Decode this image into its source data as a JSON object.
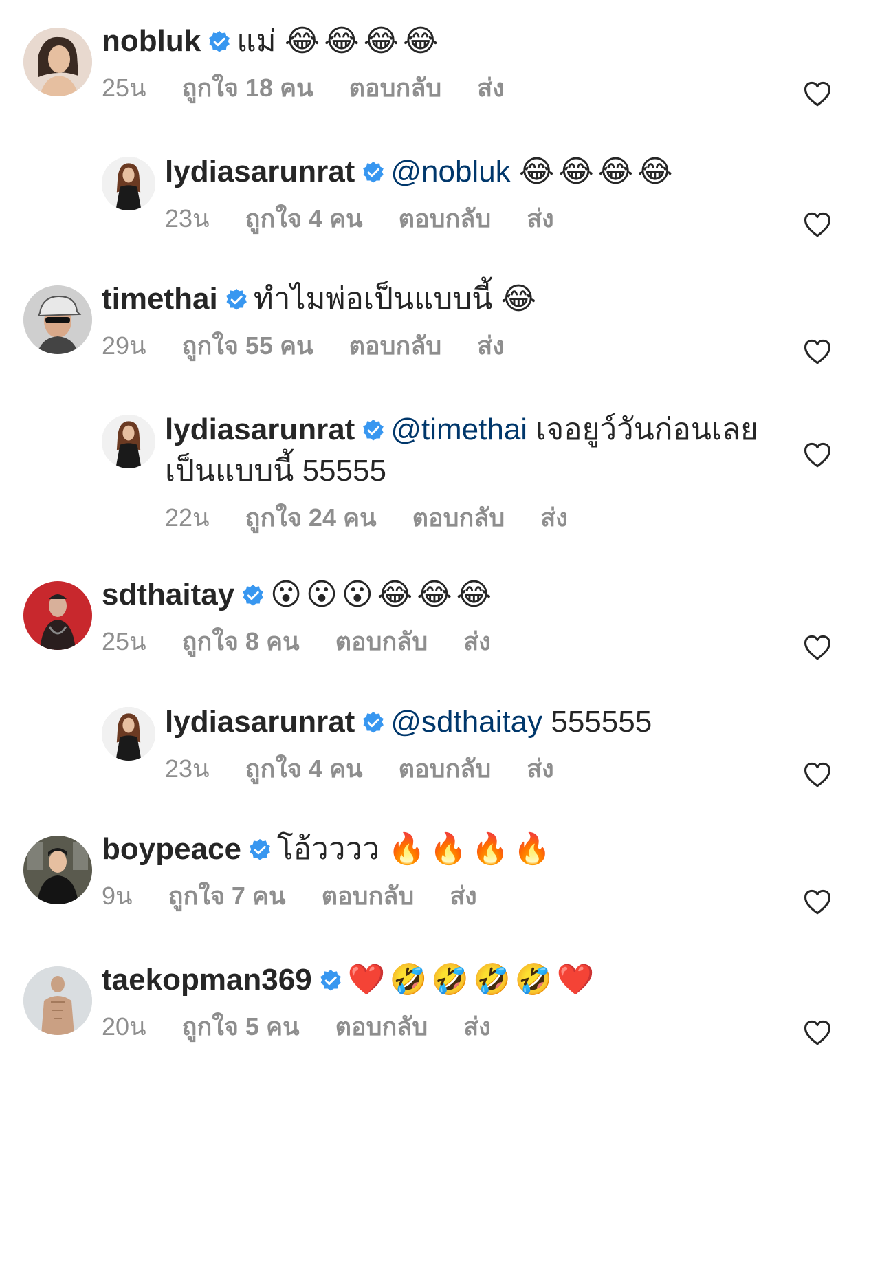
{
  "colors": {
    "text": "#262626",
    "meta": "#8e8e8e",
    "mention": "#00376b",
    "verified": "#3897f0"
  },
  "comments": [
    {
      "username": "nobluk",
      "verified": true,
      "reply": false,
      "mention": "",
      "text": "แม่",
      "emojis": "😂😂😂😂",
      "time": "25น",
      "likes": "ถูกใจ 18 คน",
      "reply_label": "ตอบกลับ",
      "send_label": "ส่ง",
      "avatar": "woman-portrait",
      "avatar_color": "#e8d9cf"
    },
    {
      "username": "lydiasarunrat",
      "verified": true,
      "reply": true,
      "mention": "@nobluk",
      "text": "",
      "emojis": "😂😂😂😂",
      "time": "23น",
      "likes": "ถูกใจ 4 คน",
      "reply_label": "ตอบกลับ",
      "send_label": "ส่ง",
      "avatar": "woman-dark-hair",
      "avatar_color": "#f1f1f1"
    },
    {
      "username": "timethai",
      "verified": true,
      "reply": false,
      "mention": "",
      "text": "ทำไมพ่อเป็นแบบนี้",
      "emojis": "😂",
      "time": "29น",
      "likes": "ถูกใจ 55 คน",
      "reply_label": "ตอบกลับ",
      "send_label": "ส่ง",
      "avatar": "man-cap-sunglasses",
      "avatar_color": "#cfcfcf"
    },
    {
      "username": "lydiasarunrat",
      "verified": true,
      "reply": true,
      "mention": "@timethai",
      "text": "เจอยูว์วันก่อนเลยเป็นแบบนี้ 55555",
      "emojis": "",
      "time": "22น",
      "likes": "ถูกใจ 24 คน",
      "reply_label": "ตอบกลับ",
      "send_label": "ส่ง",
      "avatar": "woman-dark-hair",
      "avatar_color": "#f1f1f1"
    },
    {
      "username": "sdthaitay",
      "verified": true,
      "reply": false,
      "mention": "",
      "text": "",
      "emojis": "😮😮😮😂😂😂",
      "time": "25น",
      "likes": "ถูกใจ 8 คน",
      "reply_label": "ตอบกลับ",
      "send_label": "ส่ง",
      "avatar": "man-red-background",
      "avatar_color": "#c8282d"
    },
    {
      "username": "lydiasarunrat",
      "verified": true,
      "reply": true,
      "mention": "@sdthaitay",
      "text": "555555",
      "emojis": "",
      "time": "23น",
      "likes": "ถูกใจ 4 คน",
      "reply_label": "ตอบกลับ",
      "send_label": "ส่ง",
      "avatar": "woman-dark-hair",
      "avatar_color": "#f1f1f1"
    },
    {
      "username": "boypeace",
      "verified": true,
      "reply": false,
      "mention": "",
      "text": "โอ้วววว",
      "emojis": "🔥🔥🔥🔥",
      "time": "9น",
      "likes": "ถูกใจ 7 คน",
      "reply_label": "ตอบกลับ",
      "send_label": "ส่ง",
      "avatar": "man-leather-jacket",
      "avatar_color": "#5a5a4e"
    },
    {
      "username": "taekopman369",
      "verified": true,
      "reply": false,
      "mention": "",
      "text": "",
      "emojis": "❤️🤣🤣🤣🤣❤️",
      "time": "20น",
      "likes": "ถูกใจ 5 คน",
      "reply_label": "ตอบกลับ",
      "send_label": "ส่ง",
      "avatar": "man-shirtless",
      "avatar_color": "#d9dde0"
    }
  ]
}
